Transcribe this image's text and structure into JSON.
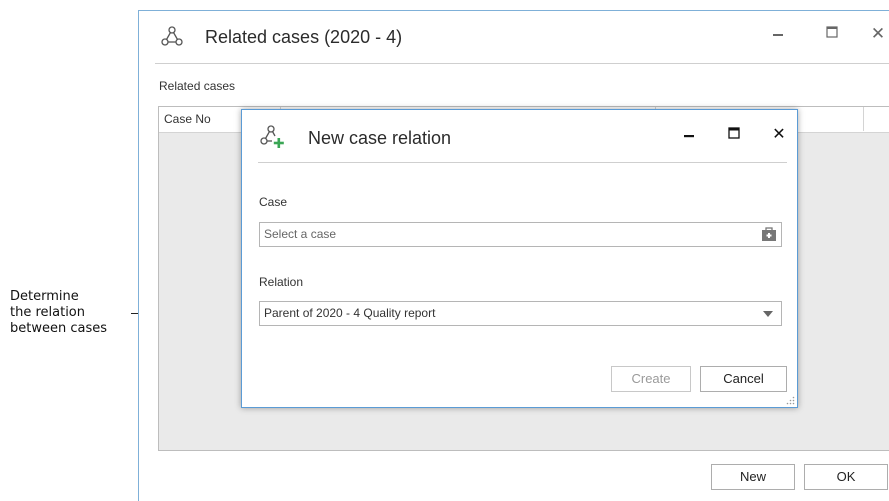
{
  "annotation": {
    "text": "Determine\nthe relation\nbetween cases"
  },
  "outer_window": {
    "title": "Related cases (2020 - 4)",
    "section_label": "Related cases",
    "grid": {
      "columns": [
        "Case No",
        "",
        ""
      ]
    },
    "buttons": {
      "new_label": "New",
      "ok_label": "OK"
    },
    "icons": {
      "window": "case-relation-icon",
      "minimize": "minimize-icon",
      "maximize": "maximize-icon",
      "close": "close-icon"
    }
  },
  "dialog": {
    "title": "New case relation",
    "case": {
      "label": "Case",
      "placeholder": "Select a case"
    },
    "relation": {
      "label": "Relation",
      "selected": "Parent of 2020 - 4 Quality report"
    },
    "buttons": {
      "create_label": "Create",
      "cancel_label": "Cancel"
    },
    "icons": {
      "window": "add-case-relation-icon",
      "picker": "case-picker-icon",
      "dropdown": "chevron-down-icon"
    }
  },
  "glyphs": {
    "minimize": "‒",
    "maximize": "☐",
    "close": "✕"
  },
  "colors": {
    "accent_border": "#5b9bd5",
    "plus_green": "#3aa655"
  }
}
